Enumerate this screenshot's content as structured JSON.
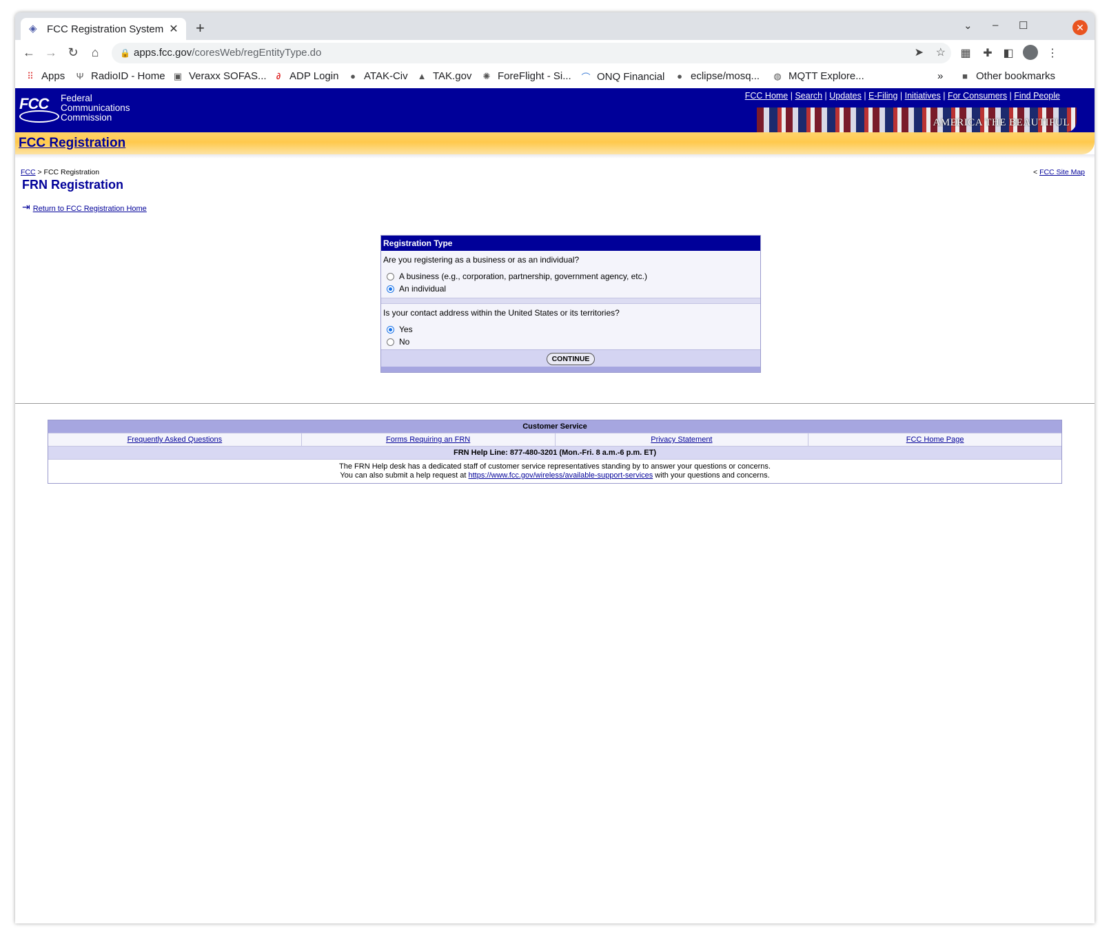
{
  "browser": {
    "tab_title": "FCC Registration System",
    "url_host": "apps.fcc.gov",
    "url_path": "/coresWeb/regEntityType.do",
    "bookmarks": [
      {
        "label": "Apps",
        "icon": "apps-grid-icon"
      },
      {
        "label": "RadioID - Home",
        "icon": "antenna-icon"
      },
      {
        "label": "Veraxx SOFAS...",
        "icon": "building-icon"
      },
      {
        "label": "ADP Login",
        "icon": "adp-icon"
      },
      {
        "label": "ATAK-Civ",
        "icon": "github-icon"
      },
      {
        "label": "TAK.gov",
        "icon": "tak-icon"
      },
      {
        "label": "ForeFlight - Si...",
        "icon": "gear-sun-icon"
      },
      {
        "label": "ONQ Financial",
        "icon": "onq-icon"
      },
      {
        "label": "eclipse/mosq...",
        "icon": "github-icon"
      },
      {
        "label": "MQTT Explore...",
        "icon": "globe-icon"
      }
    ],
    "overflow": "»",
    "other_bookmarks": "Other bookmarks"
  },
  "header": {
    "logo_mark": "FCC",
    "logo_name_1": "Federal",
    "logo_name_2": "Communications",
    "logo_name_3": "Commission",
    "links": [
      "FCC Home",
      "Search",
      "Updates",
      "E-Filing",
      "Initiatives",
      "For Consumers",
      "Find People"
    ],
    "banner_text": "AMERICA THE BEAUTIFUL",
    "section_title": "FCC Registration"
  },
  "breadcrumb": {
    "root": "FCC",
    "current": " > FCC Registration",
    "sitemap_prefix": "< ",
    "sitemap": "FCC Site Map"
  },
  "page": {
    "title": "FRN Registration",
    "return_link": "Return to FCC Registration Home"
  },
  "form": {
    "heading": "Registration Type",
    "q1": "Are you registering as a business or as an individual?",
    "q1_opt_business": "A business (e.g., corporation, partnership, government agency, etc.)",
    "q1_opt_individual": "An individual",
    "q1_selected": "An individual",
    "q2": "Is your contact address within the United States or its territories?",
    "q2_opt_yes": "Yes",
    "q2_opt_no": "No",
    "q2_selected": "Yes",
    "continue": "CONTINUE"
  },
  "customer_service": {
    "heading": "Customer Service",
    "links": [
      "Frequently Asked Questions",
      "Forms Requiring an FRN",
      "Privacy Statement",
      "FCC Home Page"
    ],
    "helpline": "FRN Help Line: 877-480-3201 (Mon.-Fri. 8 a.m.-6 p.m. ET)",
    "desc_1": "The FRN Help desk has a dedicated staff of customer service representatives standing by to answer your questions or concerns.",
    "desc_2_pre": "You can also submit a help request at ",
    "desc_2_link": "https://www.fcc.gov/wireless/available-support-services",
    "desc_2_post": " with your questions and concerns."
  }
}
